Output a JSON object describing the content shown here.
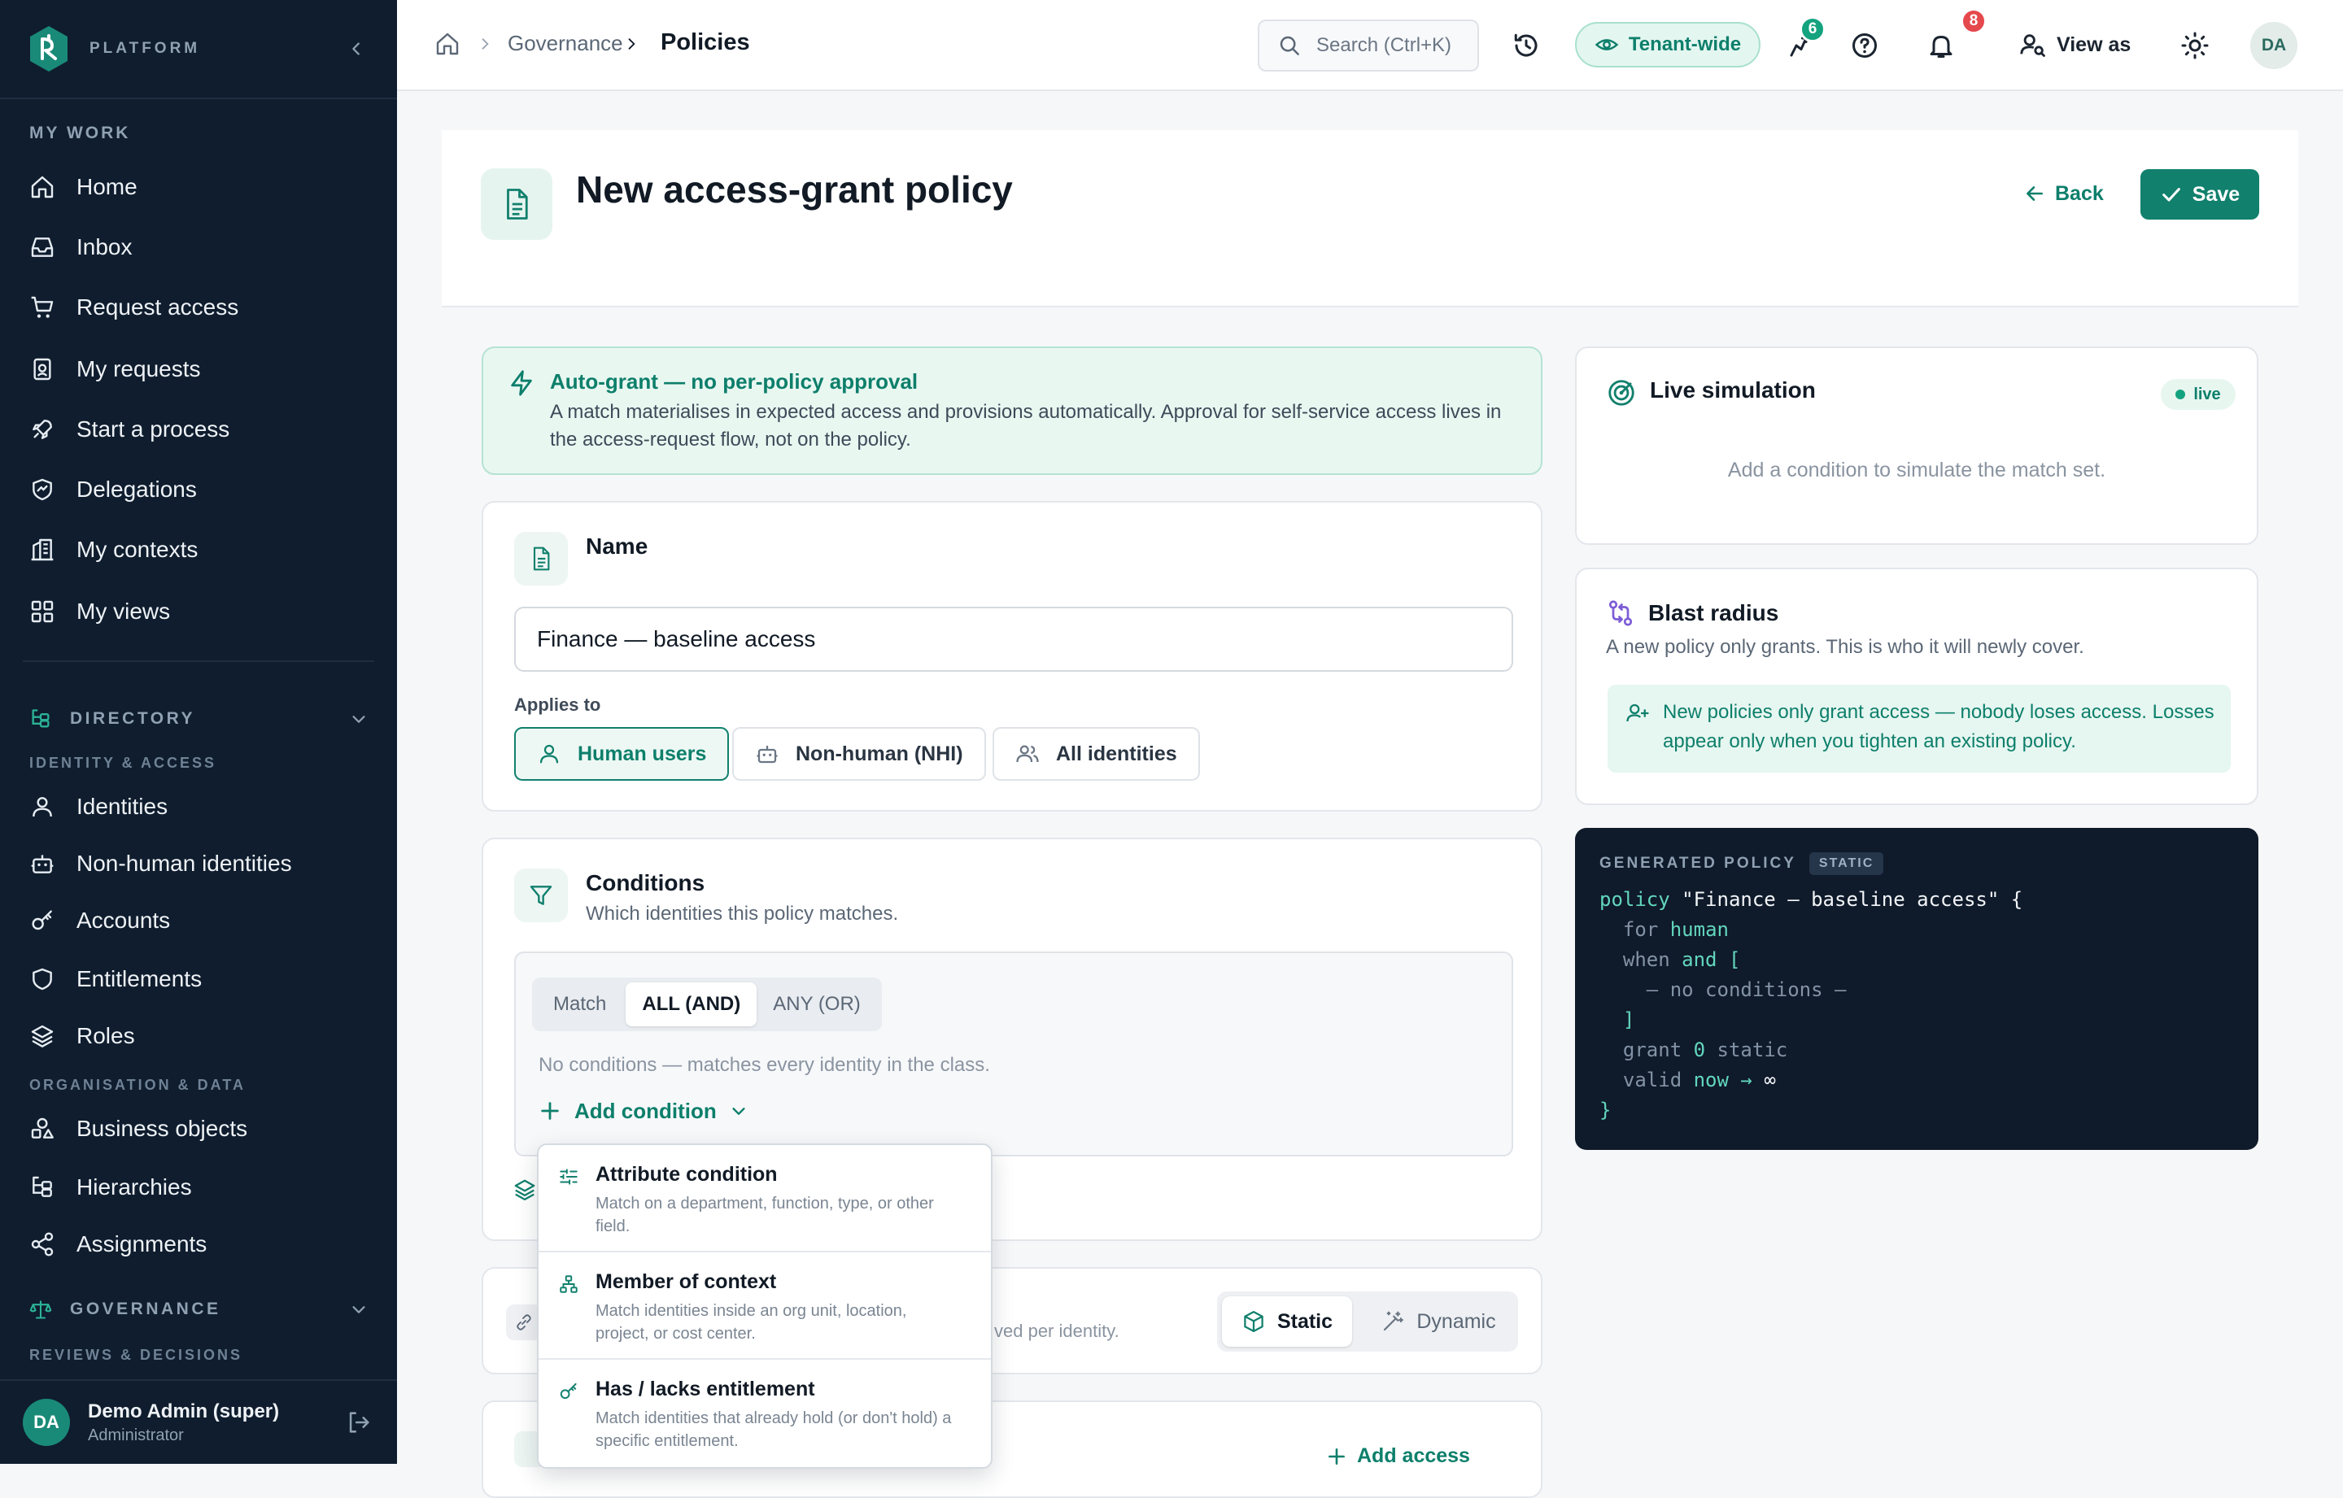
{
  "colors": {
    "sidebar_bg": "#0f1d2e",
    "accent": "#11806d",
    "accent_light": "#e9f7f1",
    "notification_badge": "#e5484d",
    "activity_badge": "#13a37e",
    "code_bg": "#0f1a2a"
  },
  "sidebar": {
    "brand": "PLATFORM",
    "my_work_label": "MY WORK",
    "my_work": [
      {
        "label": "Home",
        "icon": "home-icon"
      },
      {
        "label": "Inbox",
        "icon": "inbox-icon"
      },
      {
        "label": "Request access",
        "icon": "cart-icon"
      },
      {
        "label": "My requests",
        "icon": "requests-icon"
      },
      {
        "label": "Start a process",
        "icon": "rocket-icon"
      },
      {
        "label": "Delegations",
        "icon": "delegation-icon"
      },
      {
        "label": "My contexts",
        "icon": "contexts-icon"
      },
      {
        "label": "My views",
        "icon": "grid-icon"
      }
    ],
    "directory": {
      "label": "DIRECTORY",
      "sub_identity": "IDENTITY & ACCESS",
      "identity_items": [
        {
          "label": "Identities",
          "icon": "user-icon"
        },
        {
          "label": "Non-human identities",
          "icon": "bot-icon"
        },
        {
          "label": "Accounts",
          "icon": "key-icon"
        },
        {
          "label": "Entitlements",
          "icon": "shield-icon"
        },
        {
          "label": "Roles",
          "icon": "layers-icon"
        }
      ],
      "sub_org": "ORGANISATION & DATA",
      "org_items": [
        {
          "label": "Business objects",
          "icon": "shapes-icon"
        },
        {
          "label": "Hierarchies",
          "icon": "hierarchy-icon"
        },
        {
          "label": "Assignments",
          "icon": "share-icon"
        }
      ]
    },
    "governance": {
      "label": "GOVERNANCE",
      "sub_reviews": "REVIEWS & DECISIONS"
    },
    "user": {
      "initials": "DA",
      "name": "Demo Admin (super)",
      "role": "Administrator"
    }
  },
  "topbar": {
    "breadcrumb": [
      "Governance",
      "Policies"
    ],
    "search_placeholder": "Search (Ctrl+K)",
    "scope": "Tenant-wide",
    "activity_count": "6",
    "notification_count": "8",
    "view_as": "View as",
    "avatar_initials": "DA"
  },
  "page": {
    "title": "New access-grant policy",
    "back": "Back",
    "save": "Save"
  },
  "auto_grant": {
    "title": "Auto-grant — no per-policy approval",
    "text": "A match materialises in expected access and provisions automatically. Approval for self-service access lives in the access-request flow, not on the policy."
  },
  "name_card": {
    "title": "Name",
    "value": "Finance — baseline access",
    "applies_label": "Applies to",
    "applies_options": [
      "Human users",
      "Non-human (NHI)",
      "All identities"
    ],
    "applies_selected": "Human users"
  },
  "conditions_card": {
    "title": "Conditions",
    "subtitle": "Which identities this policy matches.",
    "match_label": "Match",
    "match_options": [
      "ALL (AND)",
      "ANY (OR)"
    ],
    "match_selected": "ALL (AND)",
    "empty_text": "No conditions — matches every identity in the class.",
    "add_condition": "Add condition"
  },
  "condition_menu": [
    {
      "title": "Attribute condition",
      "desc": "Match on a department, function, type, or other field.",
      "icon": "sliders-icon"
    },
    {
      "title": "Member of context",
      "desc": "Match identities inside an org unit, location, project, or cost center.",
      "icon": "hierarchy-icon"
    },
    {
      "title": "Has / lacks entitlement",
      "desc": "Match identities that already hold (or don't hold) a specific entitlement.",
      "icon": "key-icon"
    }
  ],
  "grant_mode": {
    "hint": "ved per identity.",
    "options": [
      "Static",
      "Dynamic"
    ],
    "selected": "Static"
  },
  "access_card": {
    "add_access": "Add access"
  },
  "simulation": {
    "title": "Live simulation",
    "status": "live",
    "empty": "Add a condition to simulate the match set."
  },
  "blast_radius": {
    "title": "Blast radius",
    "subtitle": "A new policy only grants. This is who it will newly cover.",
    "note": "New policies only grant access — nobody loses access. Losses appear only when you tighten an existing policy."
  },
  "generated_policy": {
    "title": "GENERATED POLICY",
    "badge": "STATIC",
    "policy_name": "\"Finance — baseline access\"",
    "for": "human",
    "condition_placeholder": "— no conditions —",
    "grant_count": "0",
    "grant_mode": "static",
    "valid_from": "now",
    "valid_to": "∞"
  }
}
